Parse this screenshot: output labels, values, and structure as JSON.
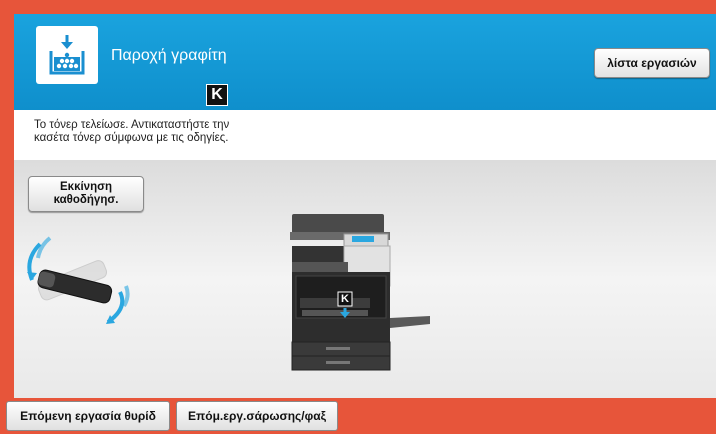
{
  "header": {
    "title": "Παροχή γραφίτη",
    "toner_color_label": "K",
    "icon": "toner-supply-icon",
    "job_list_label": "λίστα εργασιών"
  },
  "message": {
    "line1": "Το τόνερ τελείωσε. Αντικαταστήστε την",
    "line2": "κασέτα τόνερ σύμφωνα με τις οδηγίες."
  },
  "main": {
    "guide_button_line1": "Εκκίνηση",
    "guide_button_line2": "καθοδήγησ.",
    "copier_toner_label": "K"
  },
  "footer": {
    "next_job_label": "Επόμενη εργασία θυρίδ",
    "next_scan_label": "Επόμ.εργ.σάρωσης/φαξ"
  },
  "colors": {
    "frame": "#e7553a",
    "header": "#1aa3de",
    "accent_arrow": "#2aa7e0"
  }
}
